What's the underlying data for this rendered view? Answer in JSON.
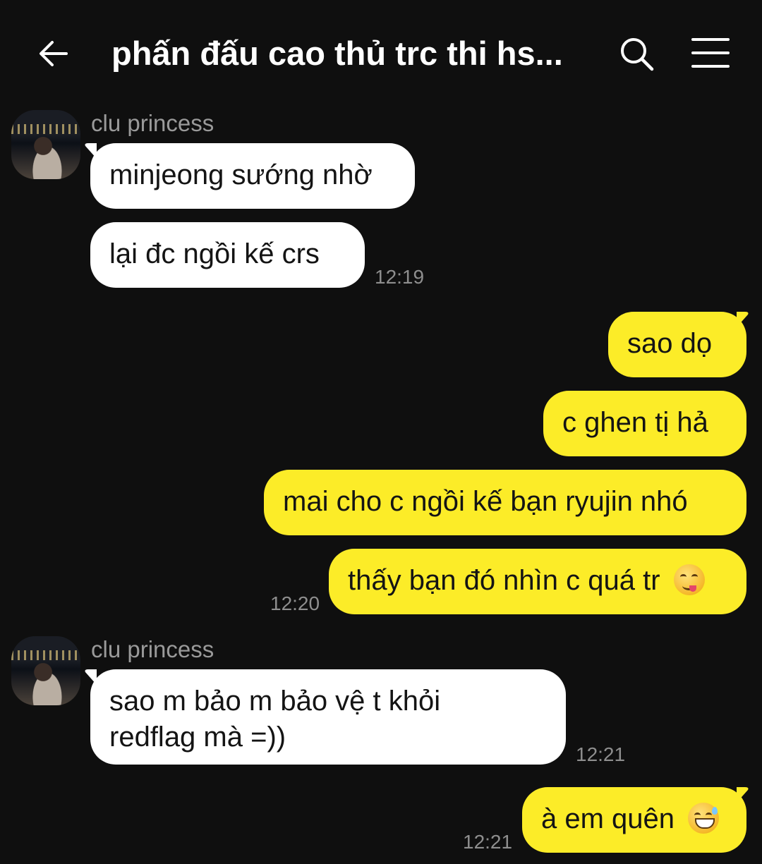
{
  "header": {
    "title": "phấn đấu cao thủ trc thi hs..."
  },
  "messages": [
    {
      "sender": "clu princess",
      "text": "minjeong sướng nhờ"
    },
    {
      "text": "lại đc ngồi kế crs",
      "time": "12:19"
    },
    {
      "text": "sao dọ"
    },
    {
      "text": "c ghen tị hả"
    },
    {
      "text": "mai cho c ngồi kế bạn ryujin nhó"
    },
    {
      "text": "thấy bạn đó nhìn c quá tr",
      "emoji": "yummy-face-emoji",
      "time": "12:20"
    },
    {
      "sender": "clu princess",
      "text_line1": "sao m bảo m bảo vệ t khỏi",
      "text_line2": "redflag mà =))",
      "time": "12:21"
    },
    {
      "text": "à em quên",
      "emoji": "grinning-sweat-emoji",
      "time": "12:21"
    }
  ],
  "colors": {
    "background": "#0f0f0f",
    "incoming_bubble": "#ffffff",
    "outgoing_bubble": "#fcec28",
    "timestamp": "#8e8e8e",
    "sender_name": "#9a9a9a"
  }
}
